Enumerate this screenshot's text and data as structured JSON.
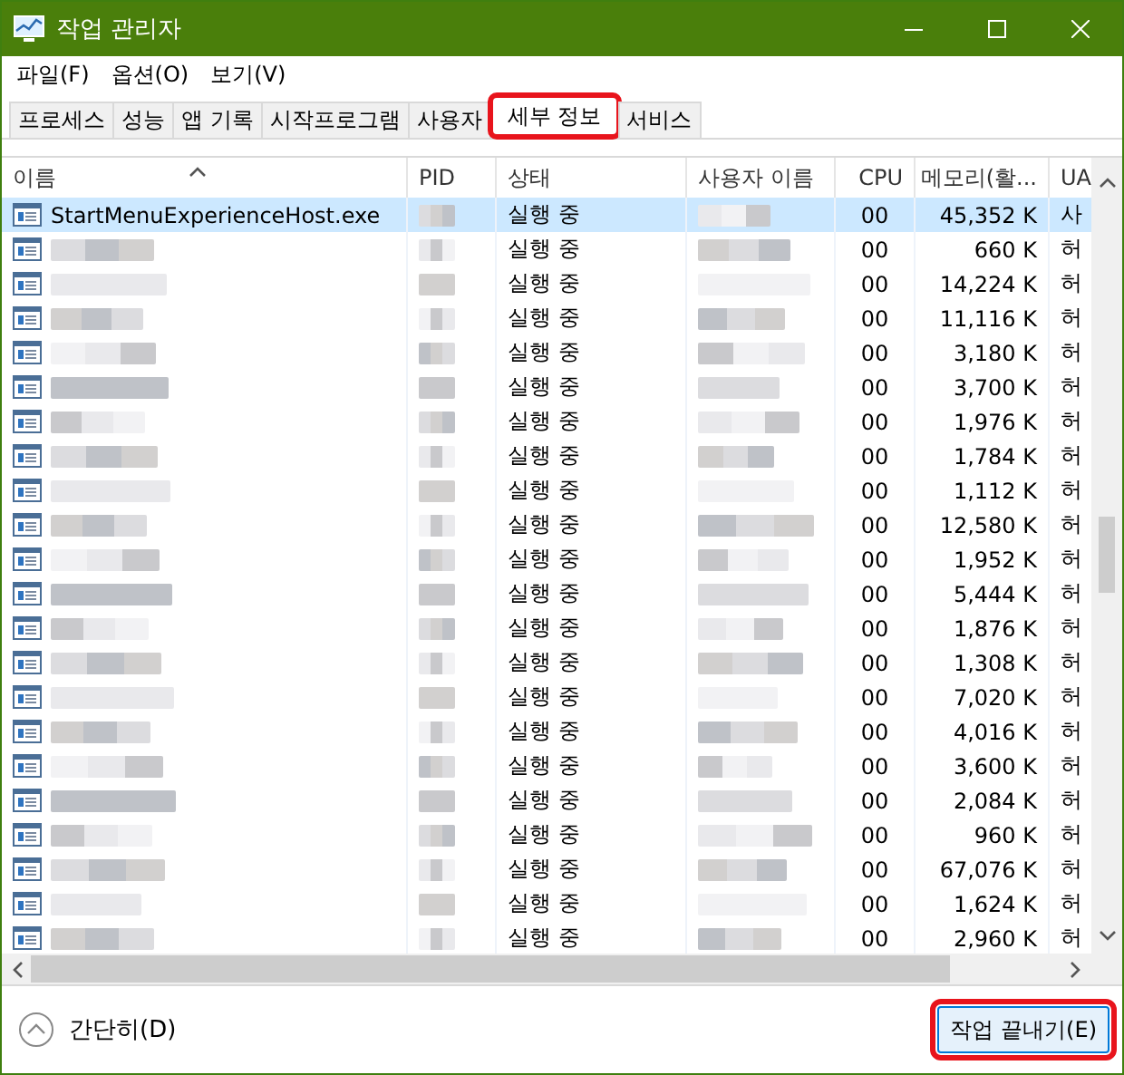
{
  "window": {
    "title": "작업 관리자"
  },
  "menu": [
    "파일(F)",
    "옵션(O)",
    "보기(V)"
  ],
  "tabs": [
    {
      "label": "프로세스",
      "selected": false,
      "highlighted": false
    },
    {
      "label": "성능",
      "selected": false,
      "highlighted": false
    },
    {
      "label": "앱 기록",
      "selected": false,
      "highlighted": false
    },
    {
      "label": "시작프로그램",
      "selected": false,
      "highlighted": false
    },
    {
      "label": "사용자",
      "selected": false,
      "highlighted": false
    },
    {
      "label": "세부 정보",
      "selected": true,
      "highlighted": true
    },
    {
      "label": "서비스",
      "selected": false,
      "highlighted": false
    }
  ],
  "table": {
    "columns": [
      "이름",
      "PID",
      "상태",
      "사용자 이름",
      "CPU",
      "메모리(활...",
      "UA"
    ],
    "rows": [
      {
        "name": "StartMenuExperienceHost.exe",
        "status": "실행 중",
        "cpu": "00",
        "memory": "45,352 K",
        "uac": "사",
        "selected": true
      },
      {
        "status": "실행 중",
        "cpu": "00",
        "memory": "660 K",
        "uac": "허",
        "selected": false
      },
      {
        "status": "실행 중",
        "cpu": "00",
        "memory": "14,224 K",
        "uac": "허",
        "selected": false
      },
      {
        "status": "실행 중",
        "cpu": "00",
        "memory": "11,116 K",
        "uac": "허",
        "selected": false
      },
      {
        "status": "실행 중",
        "cpu": "00",
        "memory": "3,180 K",
        "uac": "허",
        "selected": false
      },
      {
        "status": "실행 중",
        "cpu": "00",
        "memory": "3,700 K",
        "uac": "허",
        "selected": false
      },
      {
        "status": "실행 중",
        "cpu": "00",
        "memory": "1,976 K",
        "uac": "허",
        "selected": false
      },
      {
        "status": "실행 중",
        "cpu": "00",
        "memory": "1,784 K",
        "uac": "허",
        "selected": false
      },
      {
        "status": "실행 중",
        "cpu": "00",
        "memory": "1,112 K",
        "uac": "허",
        "selected": false
      },
      {
        "status": "실행 중",
        "cpu": "00",
        "memory": "12,580 K",
        "uac": "허",
        "selected": false
      },
      {
        "status": "실행 중",
        "cpu": "00",
        "memory": "1,952 K",
        "uac": "허",
        "selected": false
      },
      {
        "status": "실행 중",
        "cpu": "00",
        "memory": "5,444 K",
        "uac": "허",
        "selected": false
      },
      {
        "status": "실행 중",
        "cpu": "00",
        "memory": "1,876 K",
        "uac": "허",
        "selected": false
      },
      {
        "status": "실행 중",
        "cpu": "00",
        "memory": "1,308 K",
        "uac": "허",
        "selected": false
      },
      {
        "status": "실행 중",
        "cpu": "00",
        "memory": "7,020 K",
        "uac": "허",
        "selected": false
      },
      {
        "status": "실행 중",
        "cpu": "00",
        "memory": "4,016 K",
        "uac": "허",
        "selected": false
      },
      {
        "status": "실행 중",
        "cpu": "00",
        "memory": "3,600 K",
        "uac": "허",
        "selected": false
      },
      {
        "status": "실행 중",
        "cpu": "00",
        "memory": "2,084 K",
        "uac": "허",
        "selected": false
      },
      {
        "status": "실행 중",
        "cpu": "00",
        "memory": "960 K",
        "uac": "허",
        "selected": false
      },
      {
        "status": "실행 중",
        "cpu": "00",
        "memory": "67,076 K",
        "uac": "허",
        "selected": false
      },
      {
        "status": "실행 중",
        "cpu": "00",
        "memory": "1,624 K",
        "uac": "허",
        "selected": false
      },
      {
        "status": "실행 중",
        "cpu": "00",
        "memory": "2,960 K",
        "uac": "허",
        "selected": false
      }
    ]
  },
  "footer": {
    "toggle": "간단히(D)",
    "end_task": {
      "label": "작업 끝내기(E)",
      "highlighted": true
    }
  }
}
